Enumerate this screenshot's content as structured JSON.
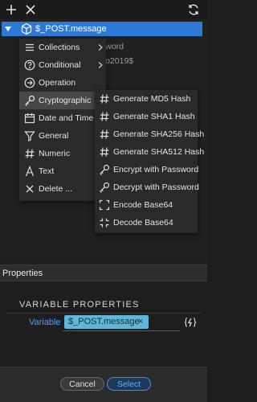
{
  "toolbar": {
    "add_icon": "plus-icon",
    "close_icon": "close-icon",
    "refresh_icon": "refresh-icon"
  },
  "tree": {
    "selected_label": "$_POST.message",
    "background_texts": [
      "sword",
      "oko2019$"
    ]
  },
  "context_menu": {
    "items": [
      {
        "label": "Collections",
        "icon": "list-icon",
        "has_submenu": true
      },
      {
        "label": "Conditional",
        "icon": "question-circle-icon",
        "has_submenu": true
      },
      {
        "label": "Operation",
        "icon": "arrow-circle-icon",
        "has_submenu": false
      },
      {
        "label": "Cryptographic",
        "icon": "key-icon",
        "has_submenu": false,
        "active": true
      },
      {
        "label": "Date and Time",
        "icon": "calendar-icon",
        "has_submenu": false
      },
      {
        "label": "General",
        "icon": "filter-icon",
        "has_submenu": false
      },
      {
        "label": "Numeric",
        "icon": "hash-icon",
        "has_submenu": false
      },
      {
        "label": "Text",
        "icon": "text-icon",
        "has_submenu": false
      },
      {
        "label": "Delete ...",
        "icon": "close-icon",
        "has_submenu": false
      }
    ]
  },
  "submenu": {
    "items": [
      {
        "label": "Generate MD5 Hash",
        "icon": "hash-icon"
      },
      {
        "label": "Generate SHA1 Hash",
        "icon": "hash-icon"
      },
      {
        "label": "Generate SHA256 Hash",
        "icon": "hash-icon"
      },
      {
        "label": "Generate SHA512 Hash",
        "icon": "hash-icon"
      },
      {
        "label": "Encrypt with Password",
        "icon": "key-icon"
      },
      {
        "label": "Decrypt with Password",
        "icon": "key-icon"
      },
      {
        "label": "Encode Base64",
        "icon": "expand-icon"
      },
      {
        "label": "Decode Base64",
        "icon": "collapse-icon"
      }
    ]
  },
  "properties": {
    "header": "Properties",
    "section_title": "VARIABLE PROPERTIES",
    "variable_label": "Variable",
    "variable_value": "$_POST.message",
    "remove_symbol": "×",
    "dynamic_icon": "lightning-brackets-icon"
  },
  "footer": {
    "cancel_label": "Cancel",
    "select_label": "Select"
  },
  "colors": {
    "selection": "#2d7ad6",
    "variable_label": "#4ea3f5",
    "tag_bg": "#5fb6d6",
    "select_button": "#3a8fe0"
  }
}
